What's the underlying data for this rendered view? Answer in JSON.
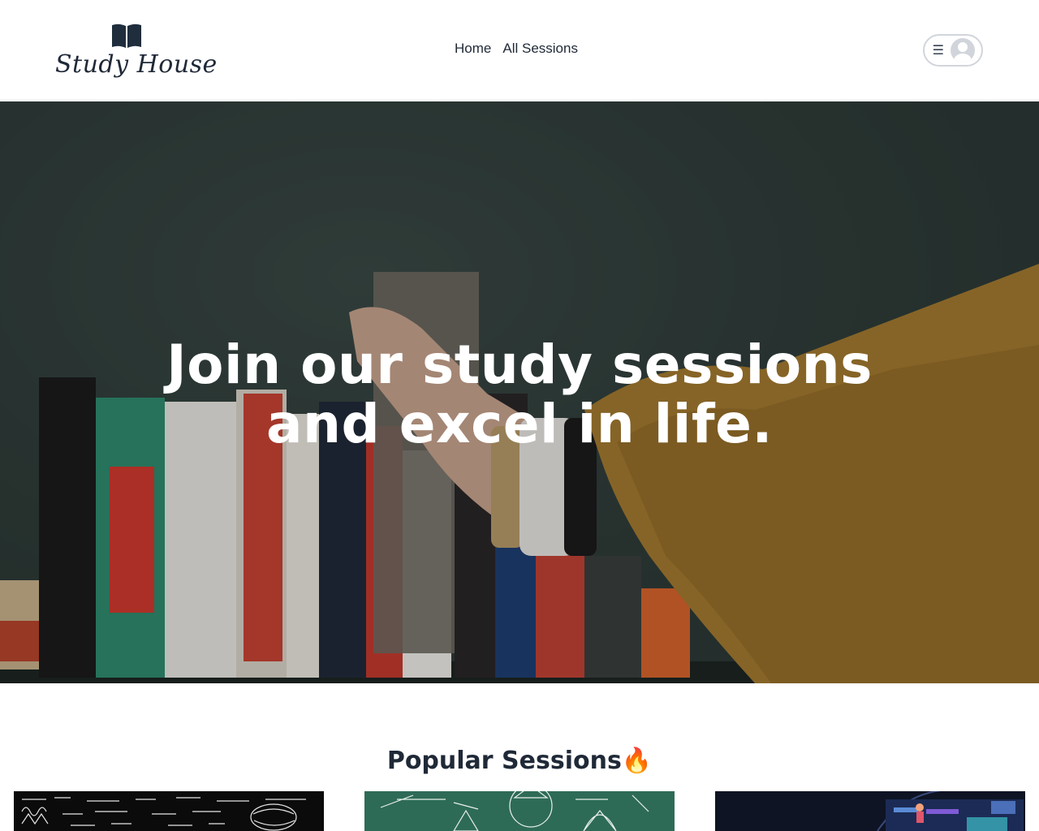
{
  "header": {
    "logo_text": "Study House",
    "nav": [
      {
        "label": "Home"
      },
      {
        "label": "All Sessions"
      }
    ],
    "menu_icon": "hamburger-icon",
    "avatar_icon": "user-avatar-icon"
  },
  "hero": {
    "title_line1": "Join our study sessions",
    "title_line2": "and excel in life."
  },
  "popular": {
    "title": "Popular Sessions",
    "title_emoji": "🔥",
    "cards": [
      {
        "image": "math-chalkboard-equations"
      },
      {
        "image": "geometry-green-chalkboard"
      },
      {
        "image": "dark-illustration-person"
      }
    ]
  },
  "colors": {
    "text_dark": "#1f2937",
    "hero_bg": "#2f3c39",
    "flame": "#f97316"
  }
}
